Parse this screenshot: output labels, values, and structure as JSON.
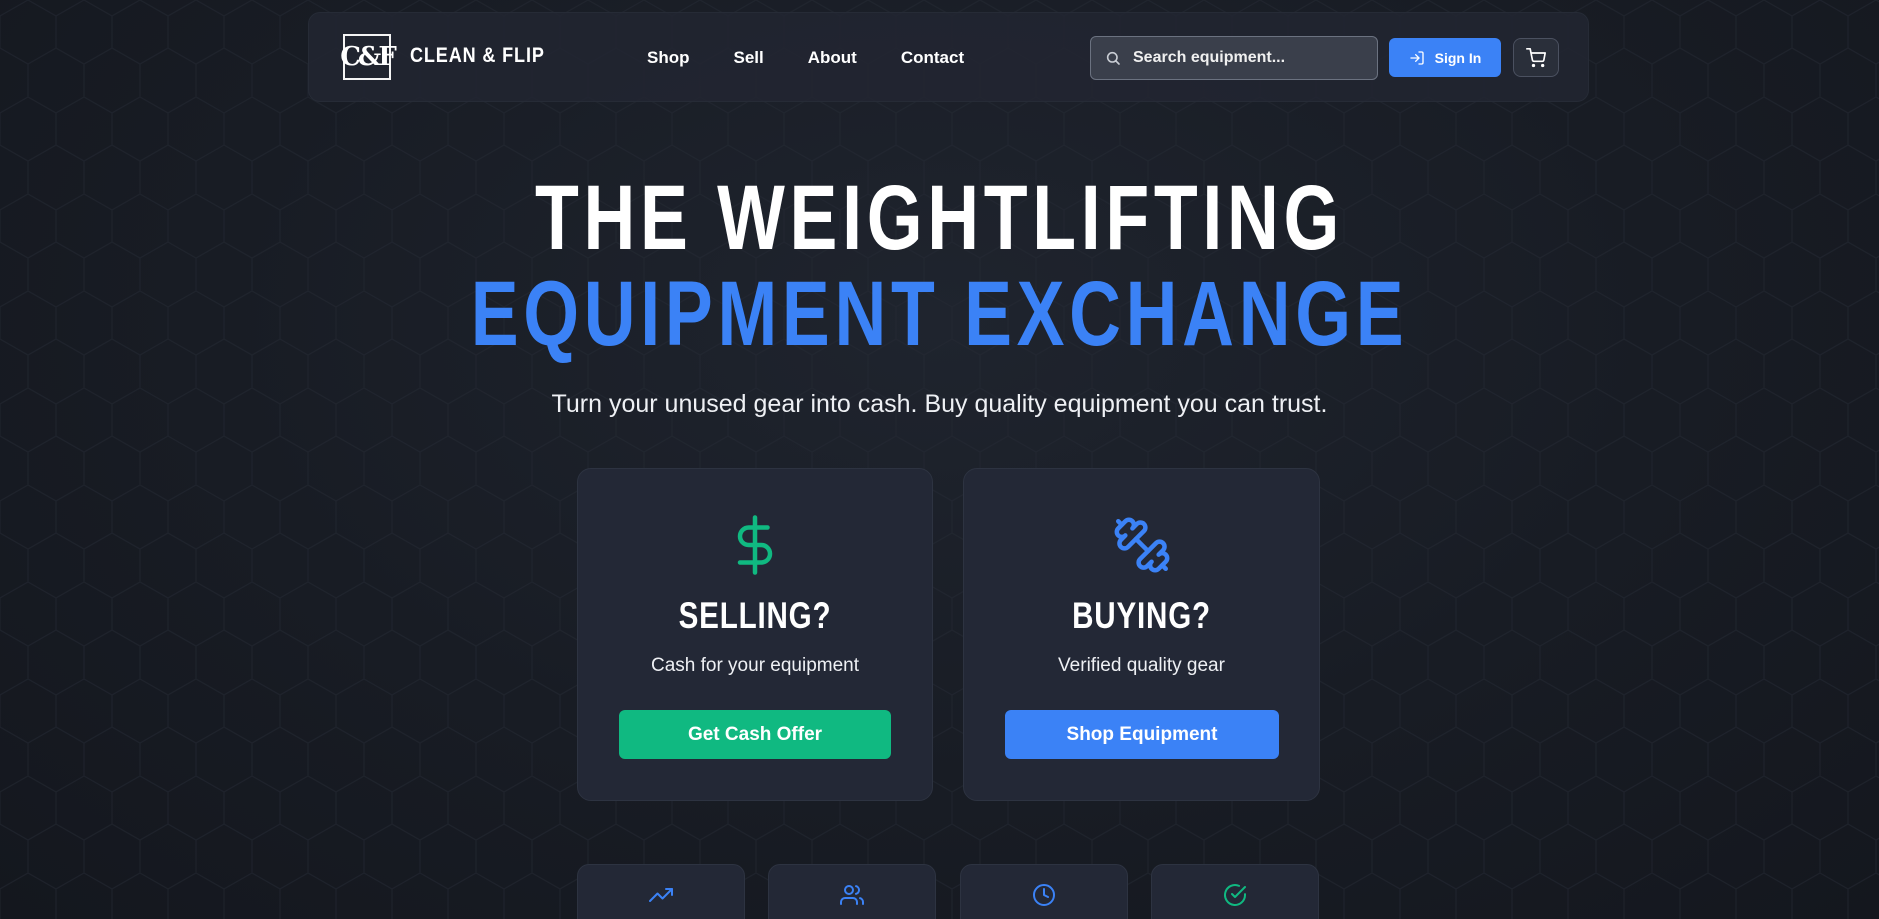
{
  "header": {
    "logo_text": "C&F",
    "brand": "CLEAN & FLIP",
    "nav": [
      {
        "label": "Shop"
      },
      {
        "label": "Sell"
      },
      {
        "label": "About"
      },
      {
        "label": "Contact"
      }
    ],
    "search": {
      "placeholder": "Search equipment..."
    },
    "sign_in_label": "Sign In"
  },
  "hero": {
    "line1": "THE WEIGHTLIFTING",
    "line2": "EQUIPMENT EXCHANGE",
    "subtitle": "Turn your unused gear into cash. Buy quality equipment you can trust."
  },
  "cards": {
    "sell": {
      "icon": "dollar-icon",
      "title": "SELLING?",
      "description": "Cash for your equipment",
      "button": "Get Cash Offer"
    },
    "buy": {
      "icon": "dumbbell-icon",
      "title": "BUYING?",
      "description": "Verified quality gear",
      "button": "Shop Equipment"
    }
  },
  "stats": [
    {
      "icon": "trending-up-icon"
    },
    {
      "icon": "users-icon"
    },
    {
      "icon": "clock-icon"
    },
    {
      "icon": "check-circle-icon"
    }
  ],
  "colors": {
    "background": "#171b23",
    "accent_blue": "#3b82f6",
    "accent_green": "#10b981",
    "card": "#232836"
  }
}
